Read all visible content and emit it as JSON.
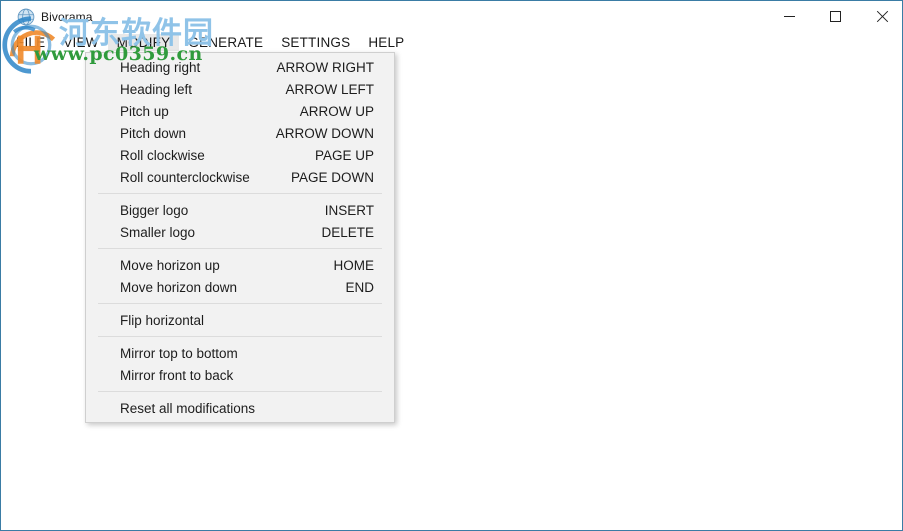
{
  "window": {
    "title": "Bivorama",
    "icon": "app-globe-icon",
    "border_color": "#3a7ca5",
    "controls": [
      {
        "name": "minimize",
        "glyph": "minimize-icon"
      },
      {
        "name": "maximize",
        "glyph": "maximize-icon"
      },
      {
        "name": "close",
        "glyph": "close-icon"
      }
    ]
  },
  "menubar": {
    "items": [
      {
        "label": "FILE",
        "active": false
      },
      {
        "label": "VIEW",
        "active": false
      },
      {
        "label": "MODIFY",
        "active": true
      },
      {
        "label": "GENERATE",
        "active": false
      },
      {
        "label": "SETTINGS",
        "active": false
      },
      {
        "label": "HELP",
        "active": false
      }
    ]
  },
  "dropdown": {
    "owner": "MODIFY",
    "groups": [
      {
        "items": [
          {
            "label": "Heading right",
            "shortcut": "ARROW RIGHT"
          },
          {
            "label": "Heading left",
            "shortcut": "ARROW LEFT"
          },
          {
            "label": "Pitch up",
            "shortcut": "ARROW UP"
          },
          {
            "label": "Pitch down",
            "shortcut": "ARROW DOWN"
          },
          {
            "label": "Roll clockwise",
            "shortcut": "PAGE UP"
          },
          {
            "label": "Roll counterclockwise",
            "shortcut": "PAGE DOWN"
          }
        ]
      },
      {
        "items": [
          {
            "label": "Bigger logo",
            "shortcut": "INSERT"
          },
          {
            "label": "Smaller logo",
            "shortcut": "DELETE"
          }
        ]
      },
      {
        "items": [
          {
            "label": "Move horizon up",
            "shortcut": "HOME"
          },
          {
            "label": "Move horizon down",
            "shortcut": "END"
          }
        ]
      },
      {
        "items": [
          {
            "label": "Flip horizontal",
            "shortcut": ""
          }
        ]
      },
      {
        "items": [
          {
            "label": "Mirror top to bottom",
            "shortcut": ""
          },
          {
            "label": "Mirror front to back",
            "shortcut": ""
          }
        ]
      },
      {
        "items": [
          {
            "label": "Reset all modifications",
            "shortcut": ""
          }
        ]
      }
    ]
  },
  "watermark": {
    "chinese_text": "河东软件园",
    "url_text": "www.pc0359.cn",
    "chinese_color": "#8fc3e8",
    "url_color": "#2f9b3c",
    "logo_blue": "#2e86c8",
    "logo_orange": "#ef8a2b"
  }
}
